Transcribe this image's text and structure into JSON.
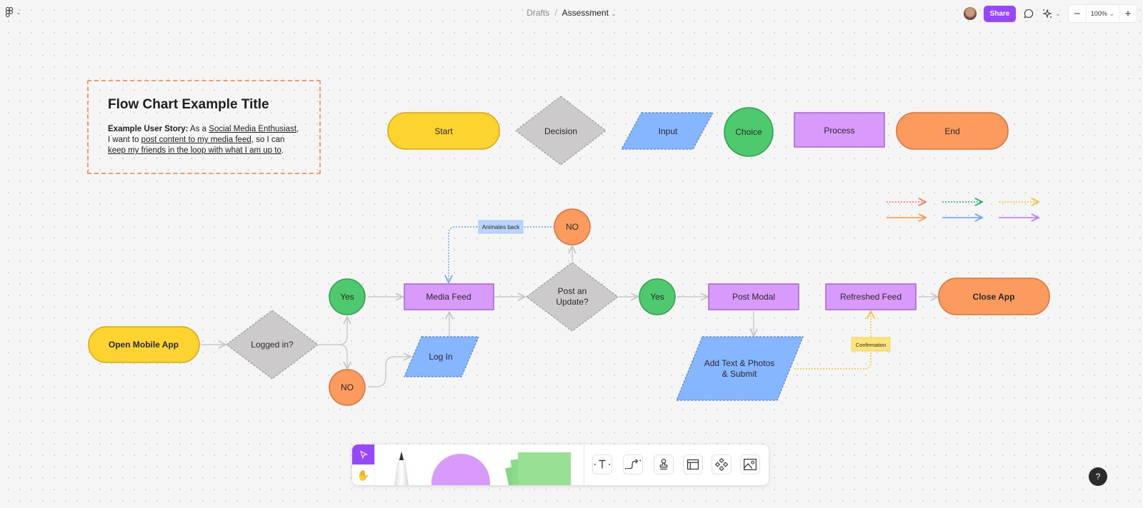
{
  "header": {
    "breadcrumb_root": "Drafts",
    "breadcrumb_sep": "/",
    "file_name": "Assessment",
    "share_label": "Share",
    "zoom_level": "100%",
    "zoom_out": "−",
    "zoom_in": "+"
  },
  "story": {
    "title": "Flow Chart Example Title",
    "label": "Example User Story:",
    "t1": " As a ",
    "u1": "Social Media Enthusiast",
    "t2": ", I want to ",
    "u2": "post content to my media feed",
    "t3": ", so I can ",
    "u3": "keep my friends in the loop with what I am up to",
    "t4": "."
  },
  "legend_shapes": {
    "start": "Start",
    "decision": "Decision",
    "input": "Input",
    "choice": "Choice",
    "process": "Process",
    "end": "End"
  },
  "flow": {
    "open_app": "Open Mobile App",
    "logged_in": "Logged in?",
    "yes1": "Yes",
    "no1": "NO",
    "media_feed": "Media Feed",
    "log_in": "Log In",
    "post_update_l1": "Post an",
    "post_update_l2": "Update?",
    "no2": "NO",
    "animates_back": "Animates back",
    "yes2": "Yes",
    "post_modal": "Post Modal",
    "add_text_l1": "Add Text & Photos",
    "add_text_l2": "& Submit",
    "confirmation": "Confirmation",
    "refreshed_feed": "Refreshed Feed",
    "close_app": "Close App"
  },
  "colors": {
    "yellow": "#fdd330",
    "gray": "#cccacb",
    "blue": "#85b6ff",
    "green": "#4fc96d",
    "purple": "#d89afb",
    "orange": "#fd9a5e",
    "accent": "#9747ff"
  },
  "help_label": "?"
}
